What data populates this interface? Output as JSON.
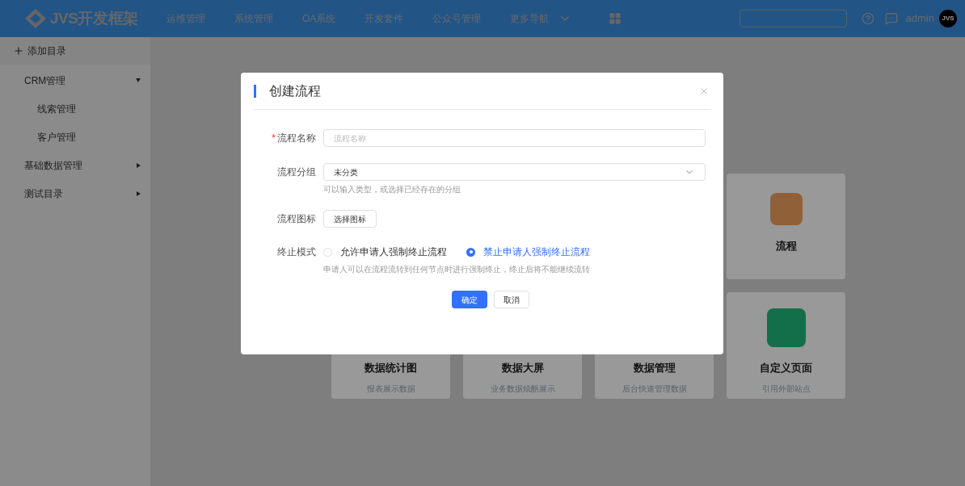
{
  "header": {
    "logo": "JVS开发框架",
    "nav": [
      {
        "label": "运维管理",
        "kind": "link"
      },
      {
        "label": "系统管理",
        "kind": "link"
      },
      {
        "label": "OA系统",
        "kind": "link"
      },
      {
        "label": "开发套件",
        "kind": "link"
      },
      {
        "label": "公众号管理",
        "kind": "link"
      },
      {
        "label": "更多导航",
        "kind": "dropdown"
      }
    ],
    "user": "admin",
    "avatar": "JVS"
  },
  "sidebar": {
    "add_label": "添加目录",
    "items": [
      {
        "label": "CRM管理",
        "expanded": true,
        "children": [
          {
            "label": "线索管理"
          },
          {
            "label": "客户管理"
          }
        ]
      },
      {
        "label": "基础数据管理",
        "expanded": false
      },
      {
        "label": "测试目录",
        "expanded": false
      }
    ]
  },
  "cards": [
    {
      "kind": "partial",
      "title": "流程"
    },
    {
      "kind": "covered",
      "title": "数据统计图",
      "subtitle": "报表展示数据"
    },
    {
      "kind": "covered",
      "title": "数据大屏",
      "subtitle": "业务数据炫酷展示"
    },
    {
      "kind": "covered",
      "title": "数据管理",
      "subtitle": "后台快速管理数据"
    },
    {
      "kind": "full",
      "title": "自定义页面",
      "subtitle": "引用外部站点"
    }
  ],
  "dialog": {
    "title": "创建流程",
    "fields": [
      {
        "kind": "text",
        "required_mark": "*",
        "label": "流程名称",
        "placeholder": "流程名称"
      },
      {
        "kind": "select",
        "label": "流程分组",
        "value": "未分类",
        "help": "可以输入类型，或选择已经存在的分组"
      },
      {
        "kind": "button",
        "label": "流程图标",
        "button": "选择图标"
      },
      {
        "kind": "radio",
        "label": "终止模式",
        "options": [
          {
            "label": "允许申请人强制终止流程",
            "selected": false
          },
          {
            "label": "禁止申请人强制终止流程",
            "selected": true
          }
        ],
        "help": "申请人可以在流程流转到任何节点时进行强制终止，终止后将不能继续流转"
      }
    ],
    "buttons": [
      {
        "label": "确定",
        "kind": "primary"
      },
      {
        "label": "取消",
        "kind": "default"
      }
    ]
  }
}
